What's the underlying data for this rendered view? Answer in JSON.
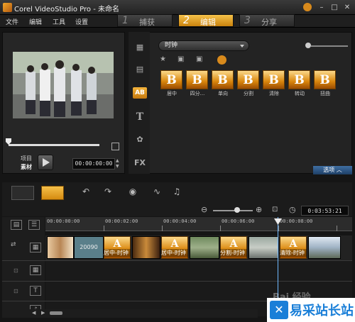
{
  "window": {
    "title": "Corel VideoStudio Pro - 未命名",
    "minimize": "–",
    "maximize": "□",
    "close": "✕"
  },
  "menu": [
    "文件",
    "编辑",
    "工具",
    "设置"
  ],
  "steps": [
    {
      "num": "1",
      "label": "捕获"
    },
    {
      "num": "2",
      "label": "编辑"
    },
    {
      "num": "3",
      "label": "分享"
    }
  ],
  "player": {
    "project_label": "项目",
    "clip_label": "素材",
    "timecode": "00:00:00:00"
  },
  "library": {
    "category": "时钟",
    "tiles": [
      {
        "glyph": "B",
        "label": "居中"
      },
      {
        "glyph": "B",
        "label": "四分..."
      },
      {
        "glyph": "B",
        "label": "单向"
      },
      {
        "glyph": "B",
        "label": "分割"
      },
      {
        "glyph": "B",
        "label": "清除"
      },
      {
        "glyph": "B",
        "label": "转动"
      },
      {
        "glyph": "B",
        "label": "扭曲"
      }
    ],
    "options_label": "选项",
    "side_icons": [
      "media-icon",
      "instant-project-icon",
      "transition-icon",
      "title-icon",
      "graphic-icon",
      "filter-icon"
    ],
    "side_glyphs": {
      "transition": "AB",
      "title": "T",
      "fx": "FX"
    }
  },
  "timeline": {
    "timecode": "0:03:53:21",
    "ruler": [
      "00:00:00:00",
      "00:00:02:00",
      "00:00:04:00",
      "00:00:06:00",
      "00:00:08:00"
    ],
    "clip_number": "20090",
    "transitions": [
      {
        "glyph": "A",
        "label": "居中-时钟"
      },
      {
        "glyph": "A",
        "label": "居中-时钟"
      },
      {
        "glyph": "A",
        "label": "分割-时钟"
      },
      {
        "glyph": "A",
        "label": "清除-时钟"
      }
    ]
  },
  "watermark": {
    "badge": "✕",
    "text": "易采站长站",
    "baidu": "Bai 经验"
  },
  "colors": {
    "accent": "#f3a72a",
    "options": "#2a5a8e",
    "playhead": "#6fb8ff"
  }
}
